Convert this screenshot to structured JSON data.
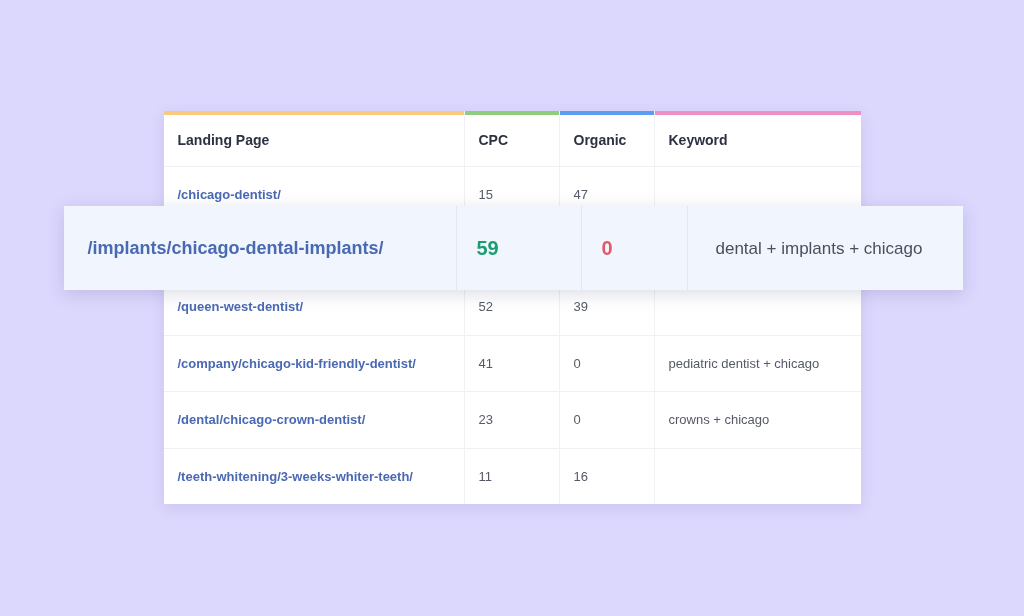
{
  "table": {
    "columns": [
      {
        "label": "Landing Page",
        "color": "#f9c97c"
      },
      {
        "label": "CPC",
        "color": "#8fcd7c"
      },
      {
        "label": "Organic",
        "color": "#5b9ef0"
      },
      {
        "label": "Keyword",
        "color": "#f08fc4"
      }
    ],
    "rows": [
      {
        "kind": "row",
        "landing_page": "/chicago-dentist/",
        "cpc": "15",
        "organic": "47"
      },
      {
        "kind": "highlighted",
        "landing_page": "/implants/chicago-dental-implants/",
        "cpc": {
          "text": "59",
          "color": "#1a9e6e"
        },
        "organic": {
          "text": "0",
          "color": "#e05a6a"
        },
        "keyword": "dental + implants + chicago"
      },
      {
        "kind": "row",
        "landing_page": "/queen-west-dentist/",
        "cpc": "52",
        "organic": "39"
      },
      {
        "kind": "row",
        "landing_page": "/company/chicago-kid-friendly-dentist/",
        "cpc": "41",
        "organic": "0",
        "keyword": "pediatric dentist + chicago"
      },
      {
        "kind": "row",
        "landing_page": "/dental/chicago-crown-dentist/",
        "cpc": "23",
        "organic": "0",
        "keyword": "crowns + chicago"
      },
      {
        "kind": "row",
        "landing_page": "/teeth-whitening/3-weeks-whiter-teeth/",
        "cpc": "11",
        "organic": "16"
      }
    ]
  }
}
